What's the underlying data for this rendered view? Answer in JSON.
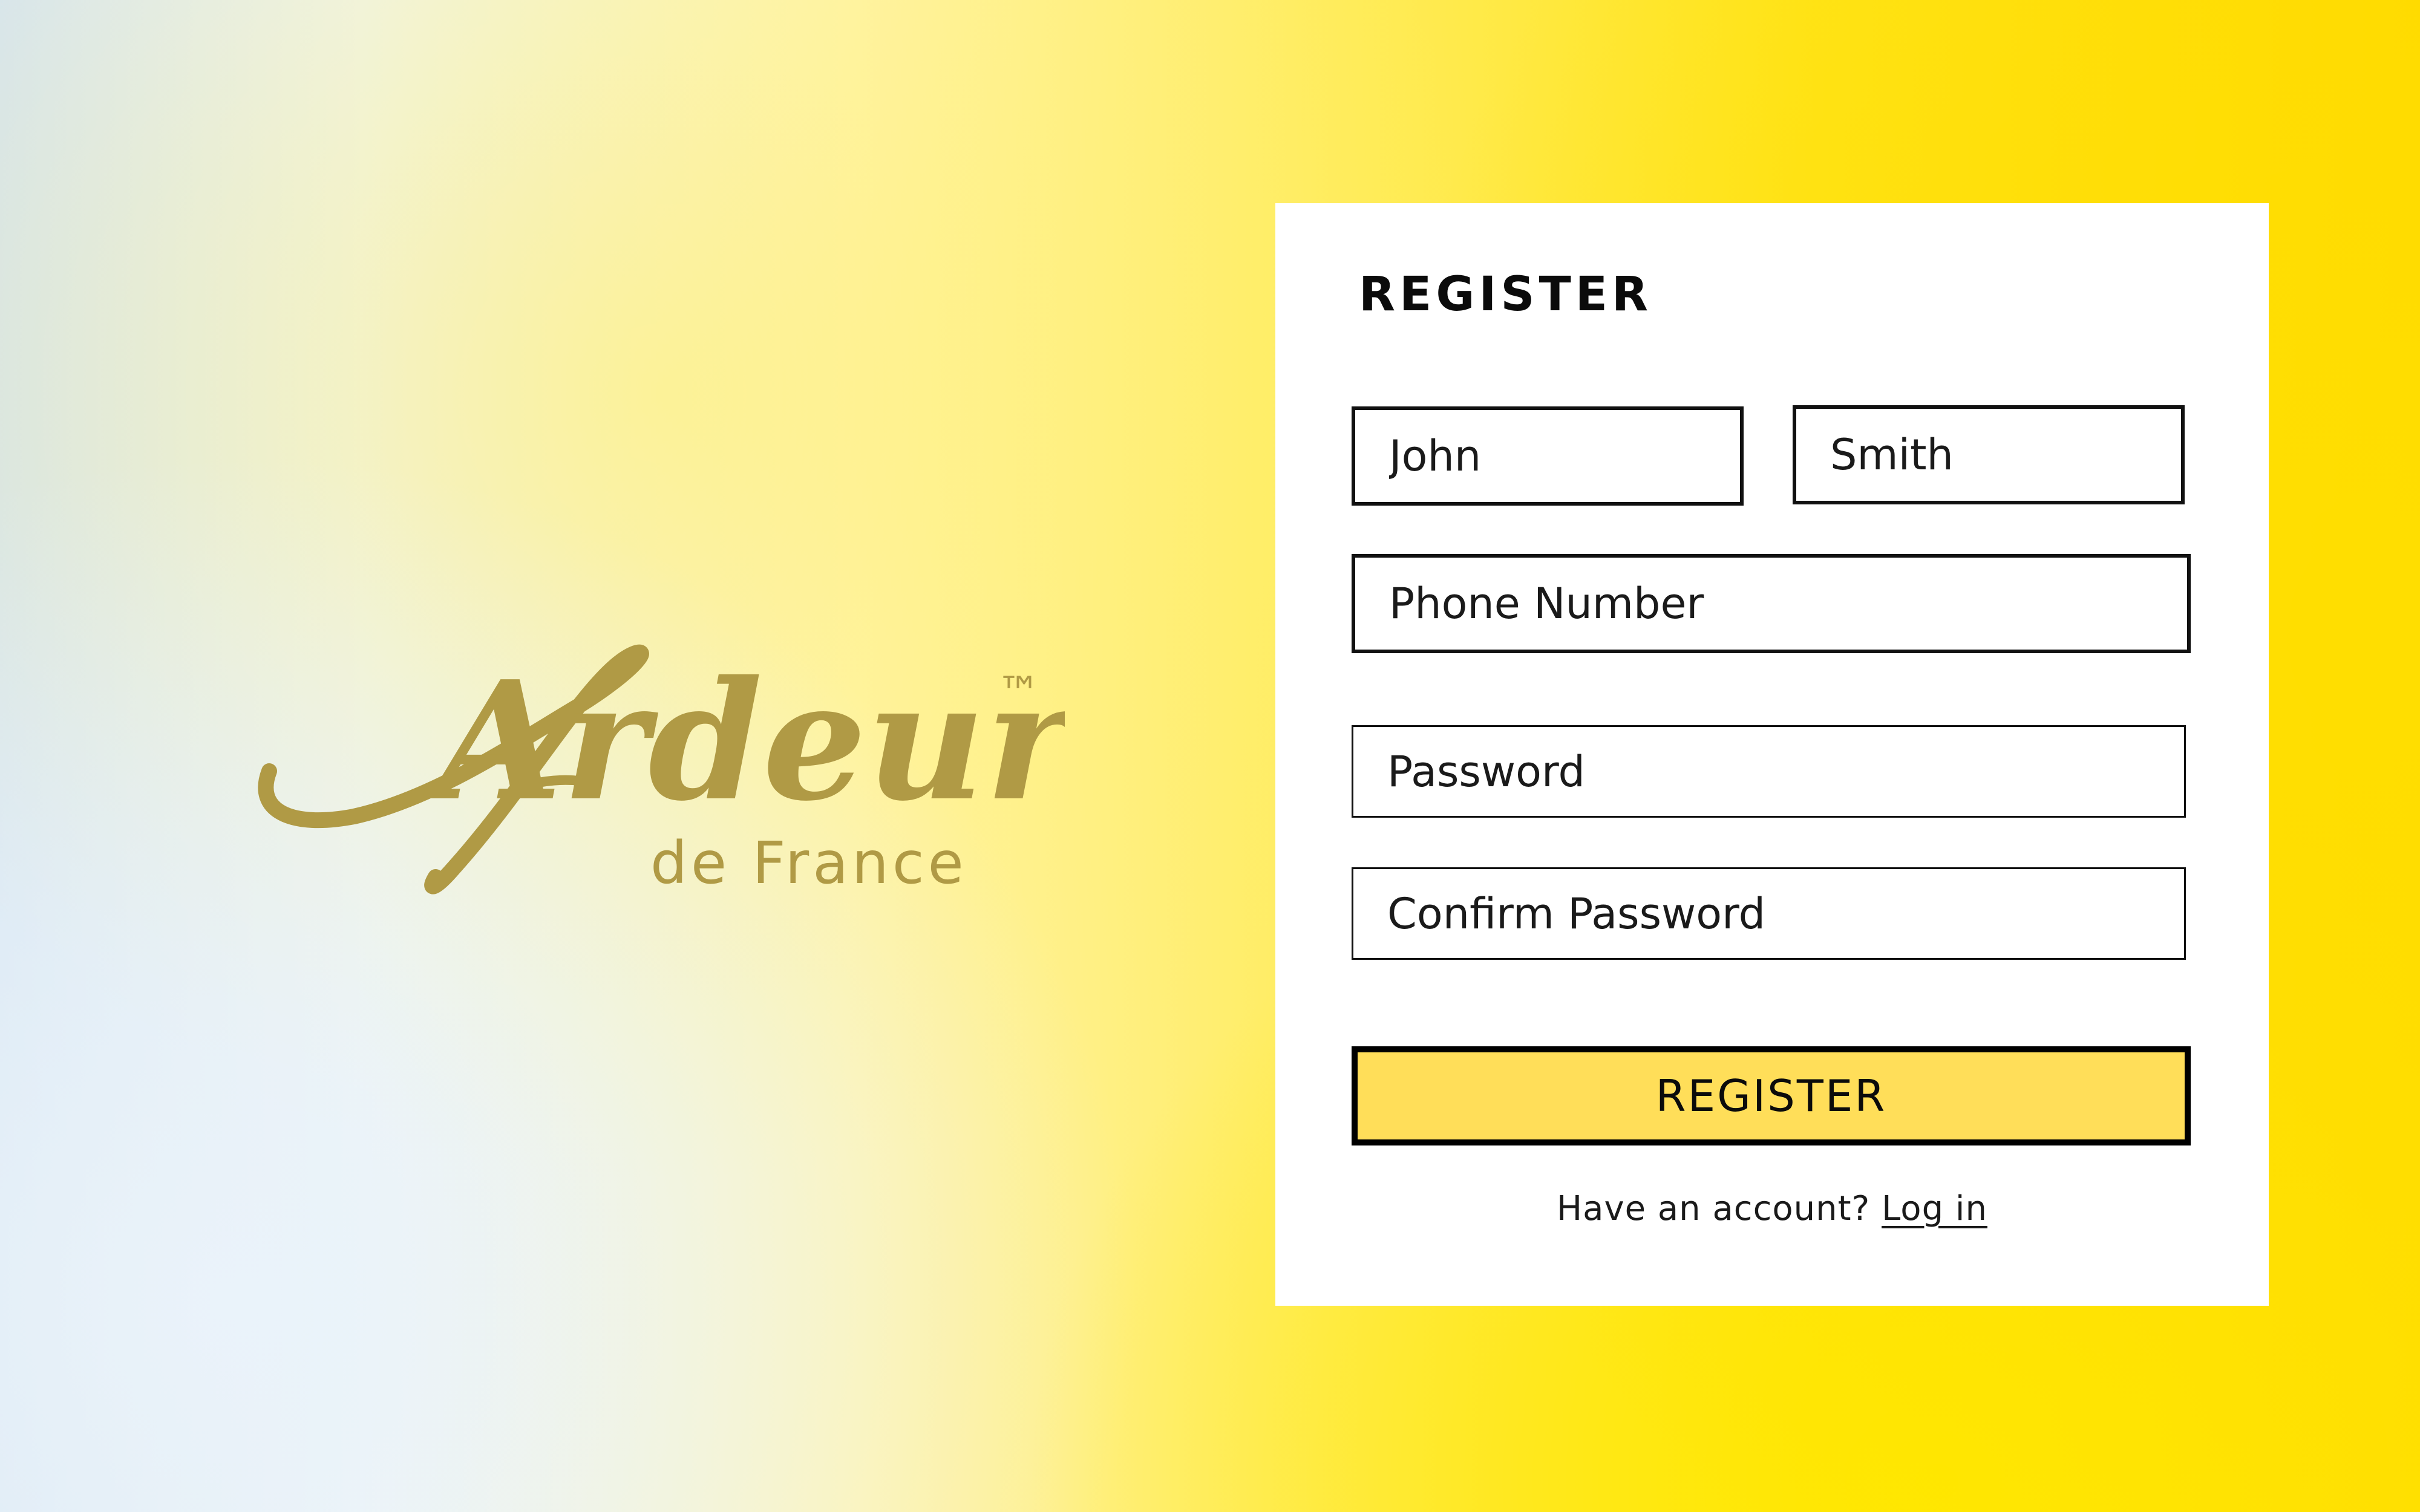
{
  "brand": {
    "name": "Ardeur",
    "subtitle": "de France",
    "trademark": "™",
    "logo_color": "#b09a45"
  },
  "form": {
    "title": "REGISTER",
    "first_name_value": "John",
    "last_name_value": "Smith",
    "phone_placeholder": "Phone Number",
    "password_placeholder": "Password",
    "confirm_password_placeholder": "Confirm Password",
    "submit_label": "REGISTER",
    "submit_color": "#ffde59",
    "account_prompt": "Have an account?",
    "login_link_label": "Log in"
  }
}
